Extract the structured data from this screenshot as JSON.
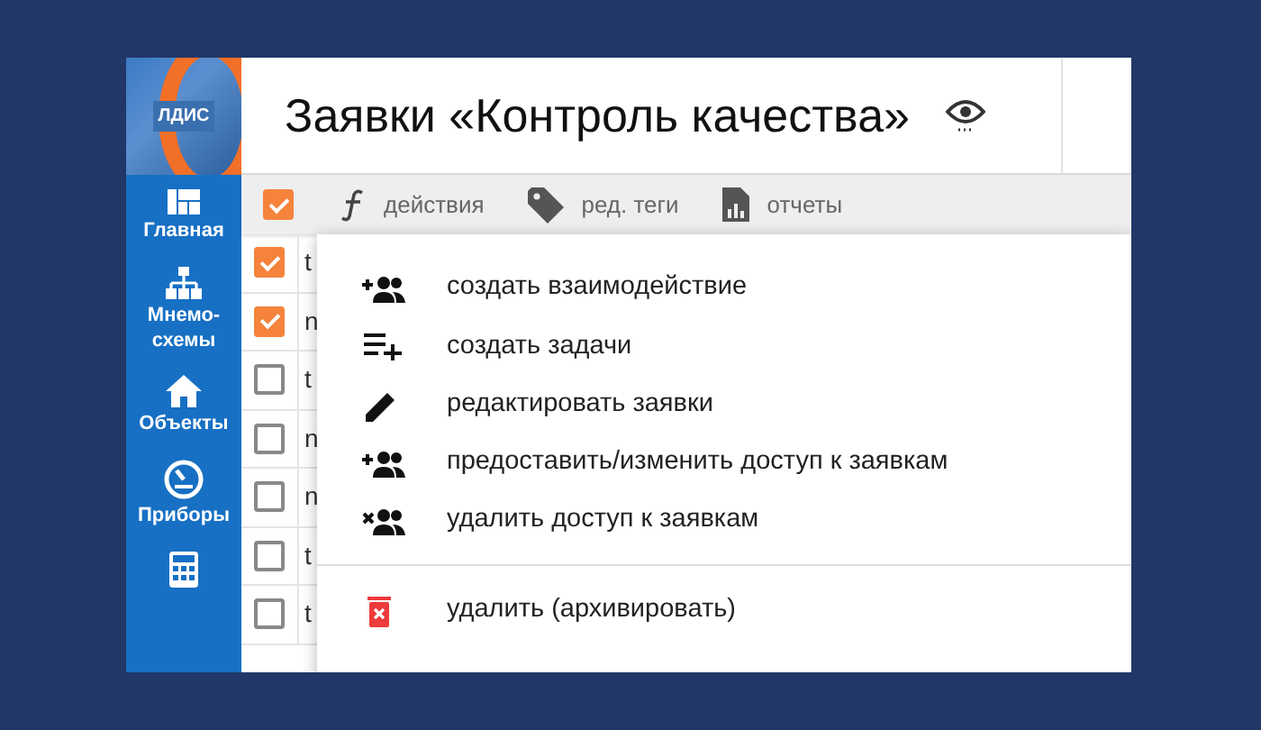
{
  "logo": {
    "text": "ЛДИС"
  },
  "sidebar": {
    "items": [
      {
        "label": "Главная"
      },
      {
        "label": "Мнемо-схемы"
      },
      {
        "label": "Объекты"
      },
      {
        "label": "Приборы"
      },
      {
        "kind": "icon"
      }
    ]
  },
  "header": {
    "title": "Заявки «Контроль качества»"
  },
  "toolbar": {
    "select_all": {
      "checked": true
    },
    "buttons": [
      {
        "label": "действия"
      },
      {
        "label": "ред. теги"
      },
      {
        "label": "отчеты"
      }
    ]
  },
  "rows": [
    {
      "checked": true,
      "text": "t"
    },
    {
      "checked": true,
      "text": "n"
    },
    {
      "checked": false,
      "text": "t"
    },
    {
      "checked": false,
      "text": "n"
    },
    {
      "checked": false,
      "text": "n"
    },
    {
      "checked": false,
      "text": "t"
    },
    {
      "checked": false,
      "text": "t"
    }
  ],
  "menu": {
    "groups": [
      [
        {
          "label": "создать взаимодействие",
          "kind": "add"
        },
        {
          "label": "создать задачи",
          "kind": "list"
        },
        {
          "label": "редактировать заявки",
          "kind": "edit"
        },
        {
          "label": "предоставить/изменить доступ к заявкам",
          "kind": "add"
        },
        {
          "label": "удалить доступ к заявкам",
          "kind": "remove"
        }
      ],
      [
        {
          "label": "удалить (архивировать)",
          "kind": "delete"
        }
      ]
    ]
  }
}
